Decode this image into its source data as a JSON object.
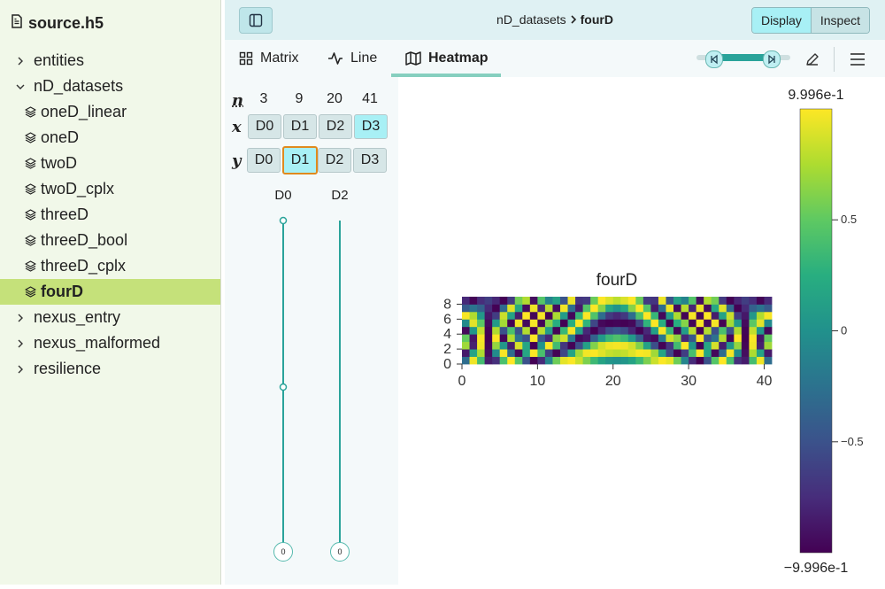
{
  "file": {
    "name": "source.h5"
  },
  "tree": [
    {
      "label": "entities",
      "type": "group",
      "expanded": false,
      "level": 0
    },
    {
      "label": "nD_datasets",
      "type": "group",
      "expanded": true,
      "level": 0
    },
    {
      "label": "oneD_linear",
      "type": "dataset",
      "level": 1
    },
    {
      "label": "oneD",
      "type": "dataset",
      "level": 1
    },
    {
      "label": "twoD",
      "type": "dataset",
      "level": 1
    },
    {
      "label": "twoD_cplx",
      "type": "dataset",
      "level": 1
    },
    {
      "label": "threeD",
      "type": "dataset",
      "level": 1
    },
    {
      "label": "threeD_bool",
      "type": "dataset",
      "level": 1
    },
    {
      "label": "threeD_cplx",
      "type": "dataset",
      "level": 1
    },
    {
      "label": "fourD",
      "type": "dataset",
      "level": 1,
      "selected": true
    },
    {
      "label": "nexus_entry",
      "type": "group",
      "expanded": false,
      "level": 0
    },
    {
      "label": "nexus_malformed",
      "type": "group",
      "expanded": false,
      "level": 0
    },
    {
      "label": "resilience",
      "type": "group",
      "expanded": false,
      "level": 0
    }
  ],
  "breadcrumb": {
    "parent": "nD_datasets",
    "current": "fourD"
  },
  "mode": {
    "display": "Display",
    "inspect": "Inspect",
    "active": "display"
  },
  "tabs": [
    {
      "label": "Matrix",
      "icon": "grid-icon"
    },
    {
      "label": "Line",
      "icon": "activity-icon"
    },
    {
      "label": "Heatmap",
      "icon": "map-icon",
      "active": true
    }
  ],
  "mapper": {
    "labels": {
      "n": "n",
      "x": "x",
      "y": "y"
    },
    "sizes": [
      "3",
      "9",
      "20",
      "41"
    ],
    "x_dims": [
      "D0",
      "D1",
      "D2",
      "D3"
    ],
    "x_selected": "D3",
    "y_dims": [
      "D0",
      "D1",
      "D2",
      "D3"
    ],
    "y_selected": "D1",
    "sliders": [
      {
        "label": "D0",
        "value": "0",
        "max": 2
      },
      {
        "label": "D2",
        "value": "0",
        "max": 19
      }
    ]
  },
  "chart_data": {
    "type": "heatmap",
    "title": "fourD",
    "colormap": "viridis",
    "x_ticks": [
      "0",
      "10",
      "20",
      "30",
      "40"
    ],
    "y_ticks": [
      "0",
      "2",
      "4",
      "6",
      "8"
    ],
    "xlim": [
      0,
      41
    ],
    "ylim": [
      0,
      9
    ],
    "shape": [
      9,
      41
    ],
    "colorbar": {
      "max_label": "9.996e-1",
      "min_label": "−9.996e-1",
      "ticks": [
        "0.5",
        "0",
        "−0.5"
      ],
      "tick_values": [
        0.5,
        0,
        -0.5
      ],
      "range": [
        -0.9996,
        0.9996
      ]
    }
  }
}
